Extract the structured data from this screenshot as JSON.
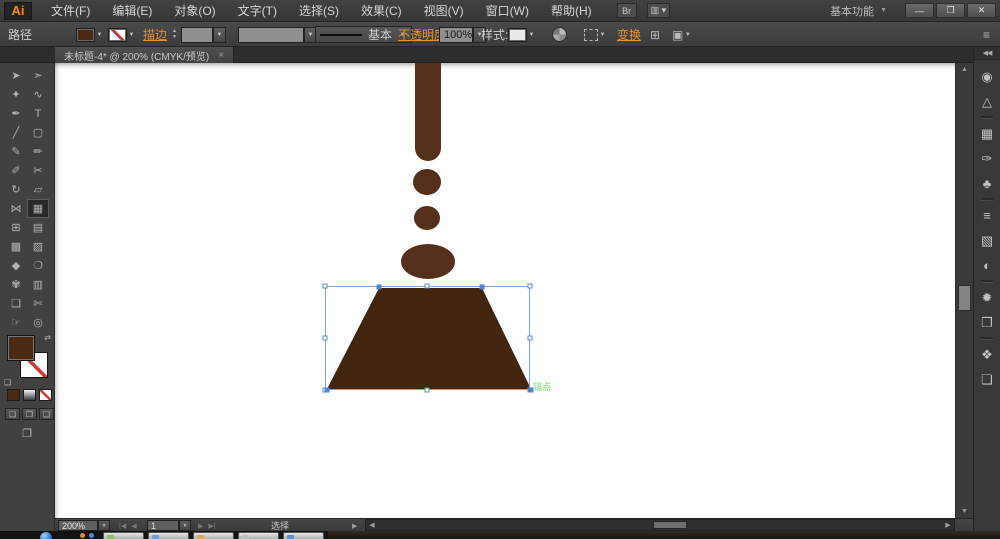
{
  "glyphs": {
    "dropdown": "▼",
    "stepper_up": "▲",
    "stepper_down": "▼",
    "scroll_up": "▲",
    "scroll_down": "▼",
    "scroll_left": "◀",
    "scroll_right": "▶",
    "section_arrow": "▶",
    "panel_menu": "≡",
    "collapse_dock": "◀◀",
    "swap_arrows": "⇄",
    "default_swatches": "❏",
    "close_tab": "×",
    "align_icon": "⊞",
    "options_icon": "▣"
  },
  "window": {
    "app_logo": "Ai",
    "menus": [
      {
        "name": "menu-file",
        "label": "文件(F)"
      },
      {
        "name": "menu-edit",
        "label": "编辑(E)"
      },
      {
        "name": "menu-object",
        "label": "对象(O)"
      },
      {
        "name": "menu-type",
        "label": "文字(T)"
      },
      {
        "name": "menu-select",
        "label": "选择(S)"
      },
      {
        "name": "menu-effect",
        "label": "效果(C)"
      },
      {
        "name": "menu-view",
        "label": "视图(V)"
      },
      {
        "name": "menu-window",
        "label": "窗口(W)"
      },
      {
        "name": "menu-help",
        "label": "帮助(H)"
      }
    ],
    "app_bar_icons": [
      {
        "name": "bridge-button",
        "glyph": "Br"
      },
      {
        "name": "arrange-documents-button",
        "glyph": "▥ ▾"
      }
    ],
    "workspace_label": "基本功能",
    "window_buttons": [
      {
        "name": "minimize-button",
        "glyph": "—"
      },
      {
        "name": "restore-button",
        "glyph": "❐"
      },
      {
        "name": "close-button",
        "glyph": "✕"
      }
    ]
  },
  "control_bar": {
    "object_label": "路径",
    "fill_color": "#4a2a12",
    "stroke_link": "描边",
    "stroke_width_value": "",
    "brush_value": "",
    "stroke_style_label": "基本",
    "opacity_link": "不透明度",
    "opacity_value": "100%",
    "style_label": "样式:",
    "transform_link": "变换"
  },
  "tab": {
    "title": "未标题-4* @ 200% (CMYK/预览)"
  },
  "toolbar": {
    "fill_color": "#4a2a12",
    "tools": [
      {
        "name": "selection-tool",
        "glyph": "➤"
      },
      {
        "name": "direct-selection-tool",
        "glyph": "➣"
      },
      {
        "name": "magic-wand-tool",
        "glyph": "✦"
      },
      {
        "name": "lasso-tool",
        "glyph": "∿"
      },
      {
        "name": "pen-tool",
        "glyph": "✒"
      },
      {
        "name": "type-tool",
        "glyph": "T"
      },
      {
        "name": "line-segment-tool",
        "glyph": "╱"
      },
      {
        "name": "shape-tool",
        "glyph": "▢"
      },
      {
        "name": "paintbrush-tool",
        "glyph": "✎"
      },
      {
        "name": "pencil-tool",
        "glyph": "✏"
      },
      {
        "name": "blob-brush-tool",
        "glyph": "✐"
      },
      {
        "name": "eraser-tool",
        "glyph": "✂"
      },
      {
        "name": "rotate-tool",
        "glyph": "↻"
      },
      {
        "name": "scale-tool",
        "glyph": "▱"
      },
      {
        "name": "width-tool",
        "glyph": "⋈"
      },
      {
        "name": "free-transform-tool",
        "glyph": "▦",
        "selected": true
      },
      {
        "name": "shape-builder-tool",
        "glyph": "⊞"
      },
      {
        "name": "perspective-grid-tool",
        "glyph": "▤"
      },
      {
        "name": "mesh-tool",
        "glyph": "▩"
      },
      {
        "name": "gradient-tool",
        "glyph": "▨"
      },
      {
        "name": "eyedropper-tool",
        "glyph": "◆"
      },
      {
        "name": "blend-tool",
        "glyph": "❍"
      },
      {
        "name": "symbol-sprayer-tool",
        "glyph": "✾"
      },
      {
        "name": "graph-tool",
        "glyph": "▥"
      },
      {
        "name": "artboard-tool",
        "glyph": "❏"
      },
      {
        "name": "slice-tool",
        "glyph": "✄"
      },
      {
        "name": "hand-tool",
        "glyph": "☞"
      },
      {
        "name": "zoom-tool",
        "glyph": "◎"
      }
    ]
  },
  "dock": {
    "icons": [
      {
        "name": "color-panel-icon",
        "glyph": "◉"
      },
      {
        "name": "color-guide-panel-icon",
        "glyph": "△"
      },
      {
        "sep": true
      },
      {
        "name": "swatches-panel-icon",
        "glyph": "▦"
      },
      {
        "name": "brushes-panel-icon",
        "glyph": "✑"
      },
      {
        "name": "symbols-panel-icon",
        "glyph": "♣"
      },
      {
        "sep": true
      },
      {
        "name": "stroke-panel-icon",
        "glyph": "≡"
      },
      {
        "name": "gradient-panel-icon",
        "glyph": "▧"
      },
      {
        "name": "transparency-panel-icon",
        "glyph": "◐"
      },
      {
        "sep": true
      },
      {
        "name": "appearance-panel-icon",
        "glyph": "✹"
      },
      {
        "name": "graphic-styles-panel-icon",
        "glyph": "❐"
      },
      {
        "sep": true
      },
      {
        "name": "layers-panel-icon",
        "glyph": "❖"
      },
      {
        "name": "artboards-panel-icon",
        "glyph": "❏"
      }
    ]
  },
  "canvas": {
    "colors": {
      "stream": "#54301a",
      "shape": "#42250f",
      "selection": "#7aa7e0",
      "anchor_label": "#74dd74"
    },
    "anchor_label": "锚点"
  },
  "status_bar": {
    "zoom_value": "200%",
    "artboard_value": "1",
    "status_text": "选择",
    "nav_left": [
      {
        "name": "first-artboard-button",
        "glyph": "|◀"
      },
      {
        "name": "prev-artboard-button",
        "glyph": "◀"
      }
    ],
    "nav_right": [
      {
        "name": "next-artboard-button",
        "glyph": "▶"
      },
      {
        "name": "last-artboard-button",
        "glyph": "▶|"
      }
    ]
  },
  "taskbar": {
    "buttons": [
      {
        "name": "taskbar-app-1",
        "color": "#8fbc6e"
      },
      {
        "name": "taskbar-app-2",
        "color": "#6f9fd6"
      },
      {
        "name": "taskbar-app-3",
        "color": "#d8a85a"
      },
      {
        "name": "taskbar-app-4",
        "color": "#bfbfbf"
      },
      {
        "name": "taskbar-app-5",
        "color": "#5d8fd0"
      }
    ]
  }
}
